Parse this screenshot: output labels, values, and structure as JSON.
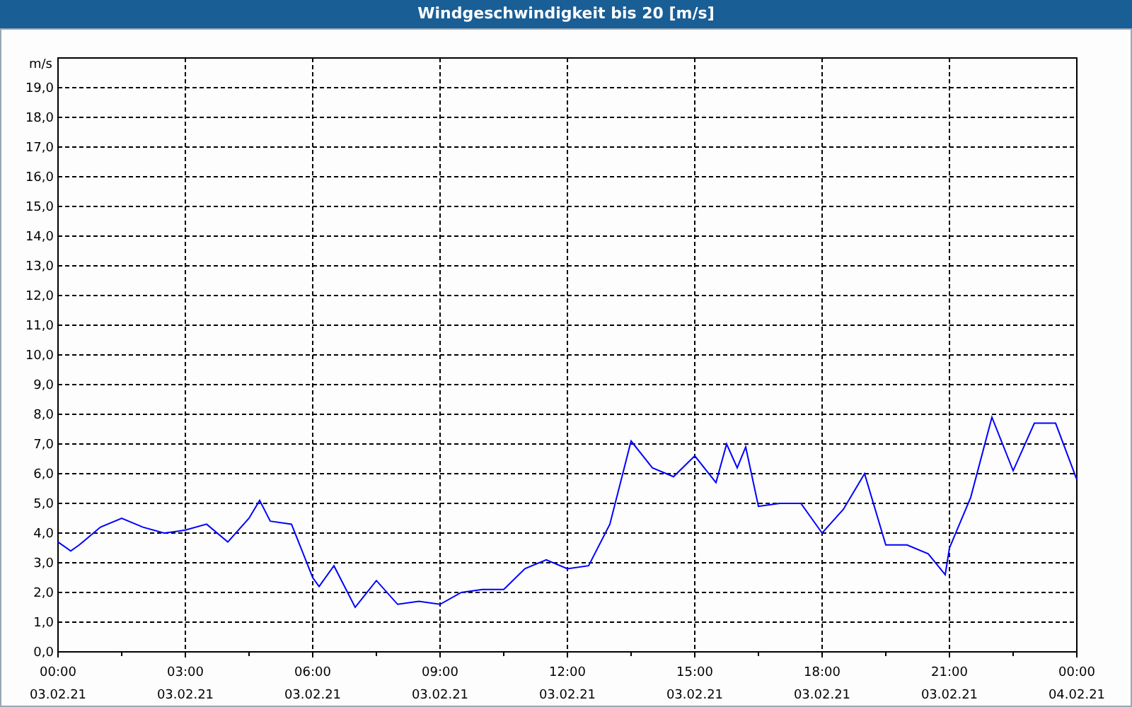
{
  "window": {
    "title": "Windgeschwindigkeit bis 20 [m/s]"
  },
  "chart": {
    "x_dates": [
      "03.02.21",
      "03.02.21",
      "03.02.21",
      "03.02.21",
      "03.02.21",
      "03.02.21",
      "03.02.21",
      "03.02.21",
      "04.02.21"
    ],
    "chart_data": {
      "type": "line",
      "grid": true,
      "ylabel": "m/s",
      "xlim": [
        0,
        24
      ],
      "ylim": [
        0,
        20
      ],
      "x": [
        0,
        0.3,
        0.5,
        1,
        1.5,
        2,
        2.5,
        3,
        3.5,
        4,
        4.5,
        4.75,
        5,
        5.5,
        6,
        6.15,
        6.5,
        7,
        7.5,
        8,
        8.5,
        9,
        9.5,
        10,
        10.5,
        11,
        11.5,
        12,
        12.5,
        13,
        13.5,
        14,
        14.5,
        15,
        15.5,
        15.75,
        16,
        16.2,
        16.5,
        17,
        17.5,
        18,
        18.5,
        19,
        19.5,
        20,
        20.5,
        20.9,
        21,
        21.5,
        22,
        22.5,
        23,
        23.5,
        24
      ],
      "series": [
        {
          "color": "#0000ff",
          "values": [
            3.7,
            3.4,
            3.6,
            4.2,
            4.5,
            4.2,
            4.0,
            4.1,
            4.3,
            3.7,
            4.5,
            5.1,
            4.4,
            4.3,
            2.5,
            2.2,
            2.9,
            1.5,
            2.4,
            1.6,
            1.7,
            1.6,
            2.0,
            2.1,
            2.1,
            2.8,
            3.1,
            2.8,
            2.9,
            4.3,
            7.1,
            6.2,
            5.9,
            6.6,
            5.7,
            7.0,
            6.2,
            6.9,
            4.9,
            5.0,
            5.0,
            4.0,
            4.8,
            6.0,
            3.6,
            3.6,
            3.3,
            2.6,
            3.5,
            5.2,
            7.9,
            6.1,
            7.7,
            7.7,
            5.8
          ]
        }
      ],
      "xticks": [
        {
          "value": 0,
          "label": "00:00"
        },
        {
          "value": 3,
          "label": "03:00"
        },
        {
          "value": 6,
          "label": "06:00"
        },
        {
          "value": 9,
          "label": "09:00"
        },
        {
          "value": 12,
          "label": "12:00"
        },
        {
          "value": 15,
          "label": "15:00"
        },
        {
          "value": 18,
          "label": "18:00"
        },
        {
          "value": 21,
          "label": "21:00"
        },
        {
          "value": 24,
          "label": "00:00"
        }
      ],
      "yticks": [
        {
          "value": 0,
          "label": "0,0"
        },
        {
          "value": 1,
          "label": "1,0"
        },
        {
          "value": 2,
          "label": "2,0"
        },
        {
          "value": 3,
          "label": "3,0"
        },
        {
          "value": 4,
          "label": "4,0"
        },
        {
          "value": 5,
          "label": "5,0"
        },
        {
          "value": 6,
          "label": "6,0"
        },
        {
          "value": 7,
          "label": "7,0"
        },
        {
          "value": 8,
          "label": "8,0"
        },
        {
          "value": 9,
          "label": "9,0"
        },
        {
          "value": 10,
          "label": "10,0"
        },
        {
          "value": 11,
          "label": "11,0"
        },
        {
          "value": 12,
          "label": "12,0"
        },
        {
          "value": 13,
          "label": "13,0"
        },
        {
          "value": 14,
          "label": "14,0"
        },
        {
          "value": 15,
          "label": "15,0"
        },
        {
          "value": 16,
          "label": "16,0"
        },
        {
          "value": 17,
          "label": "17,0"
        },
        {
          "value": 18,
          "label": "18,0"
        },
        {
          "value": 19,
          "label": "19,0"
        }
      ]
    }
  }
}
